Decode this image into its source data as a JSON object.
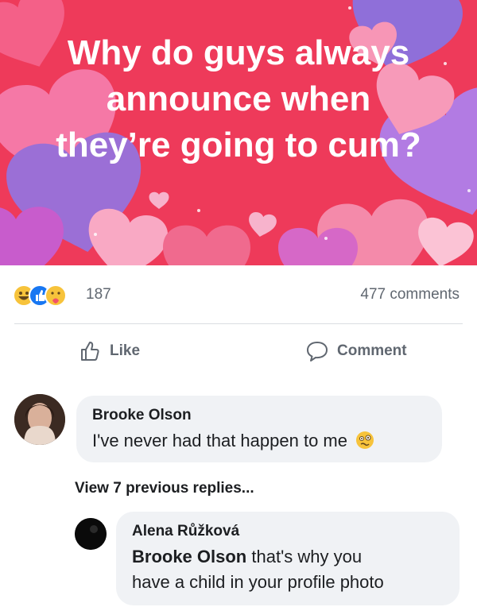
{
  "post": {
    "title_lines": [
      "Why do guys always",
      "announce when",
      "they’re going to cum?"
    ]
  },
  "stats": {
    "reaction_icons": [
      "haha-icon",
      "like-icon",
      "care-icon"
    ],
    "reaction_count": "187",
    "comments_count": "477 comments"
  },
  "actions": {
    "like_label": "Like",
    "comment_label": "Comment"
  },
  "comments": [
    {
      "author": "Brooke Olson",
      "text": "I've never had that happen to me",
      "emoji": "woozy-face-emoji"
    }
  ],
  "view_previous_replies": "View 7 previous replies...",
  "replies": [
    {
      "author": "Alena Růžková",
      "mention": "Brooke Olson",
      "text_line1": "that's why you",
      "text_line2": "have a child in your profile photo"
    }
  ],
  "colors": {
    "banner": "#ee3a5a",
    "bubble": "#f0f2f5",
    "secondary_text": "#606770"
  }
}
